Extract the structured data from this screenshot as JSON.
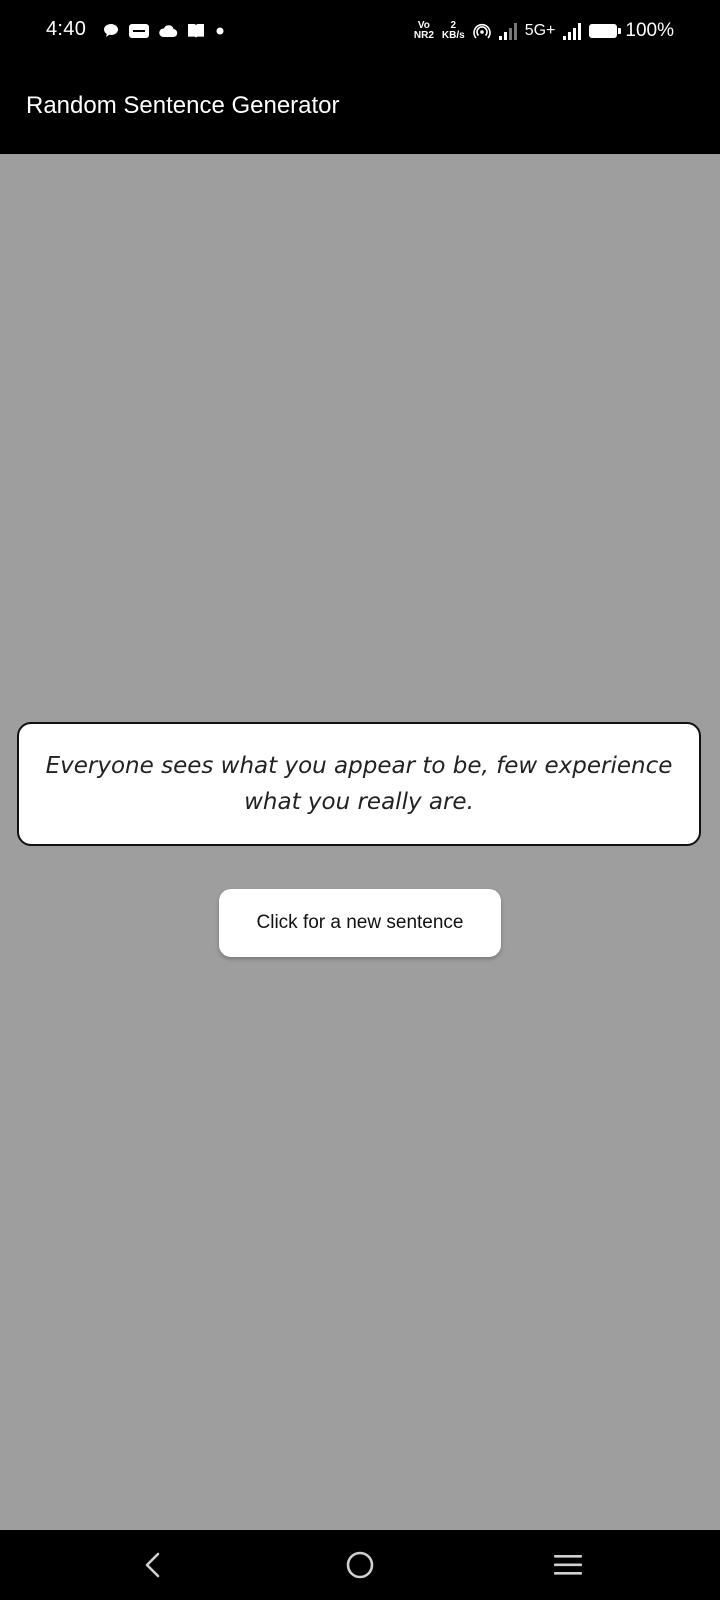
{
  "status_bar": {
    "time": "4:40",
    "volte_top": "Vo",
    "volte_bottom": "NR2",
    "speed_value": "2",
    "speed_unit": "KB/s",
    "network": "5G+",
    "battery": "100%",
    "icons": [
      "chat-bubble-icon",
      "vivo-icon",
      "cloud-icon",
      "book-icon",
      "dot-icon",
      "hotspot-icon",
      "signal-icon",
      "signal-icon",
      "battery-icon"
    ]
  },
  "app_bar": {
    "title": "Random Sentence Generator"
  },
  "main": {
    "sentence": "Everyone sees what you appear to be, few experience what you really are.",
    "button_label": "Click for a new sentence"
  },
  "nav_bar": {
    "icons": [
      "back-icon",
      "home-icon",
      "menu-icon"
    ]
  },
  "colors": {
    "background": "#9e9e9e",
    "bars": "#000000",
    "card": "#ffffff"
  }
}
